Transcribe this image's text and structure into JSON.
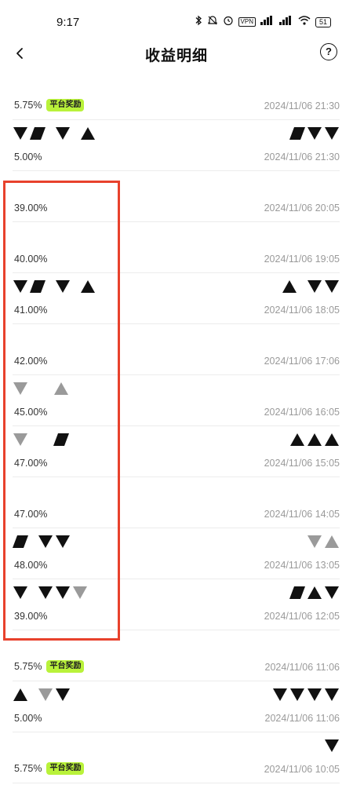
{
  "status_bar": {
    "time": "9:17",
    "vpn": "VPN",
    "battery": "51"
  },
  "header": {
    "title": "收益明细",
    "help": "?"
  },
  "records": [
    {
      "rate": "5.75%",
      "badge": "平台奖励",
      "time": "2024/11/06 21:30"
    },
    {
      "rate": "5.00%",
      "badge": "",
      "time": "2024/11/06 21:30"
    },
    {
      "rate": "39.00%",
      "badge": "",
      "time": "2024/11/06 20:05"
    },
    {
      "rate": "40.00%",
      "badge": "",
      "time": "2024/11/06 19:05"
    },
    {
      "rate": "41.00%",
      "badge": "",
      "time": "2024/11/06 18:05"
    },
    {
      "rate": "42.00%",
      "badge": "",
      "time": "2024/11/06 17:06"
    },
    {
      "rate": "45.00%",
      "badge": "",
      "time": "2024/11/06 16:05"
    },
    {
      "rate": "47.00%",
      "badge": "",
      "time": "2024/11/06 15:05"
    },
    {
      "rate": "47.00%",
      "badge": "",
      "time": "2024/11/06 14:05"
    },
    {
      "rate": "48.00%",
      "badge": "",
      "time": "2024/11/06 13:05"
    },
    {
      "rate": "39.00%",
      "badge": "",
      "time": "2024/11/06 12:05"
    },
    {
      "rate": "5.75%",
      "badge": "平台奖励",
      "time": "2024/11/06 11:06"
    },
    {
      "rate": "5.00%",
      "badge": "",
      "time": "2024/11/06 11:06"
    },
    {
      "rate": "5.75%",
      "badge": "平台奖励",
      "time": "2024/11/06 10:05"
    }
  ],
  "colors": {
    "badge_bg": "#b9f23a",
    "highlight_border": "#e8412c",
    "timestamp": "#9a9a9a"
  },
  "icons": [
    "back-arrow-icon",
    "help-icon",
    "bluetooth-icon",
    "mute-icon",
    "alarm-icon",
    "signal-icon",
    "wifi-icon",
    "battery-icon"
  ]
}
